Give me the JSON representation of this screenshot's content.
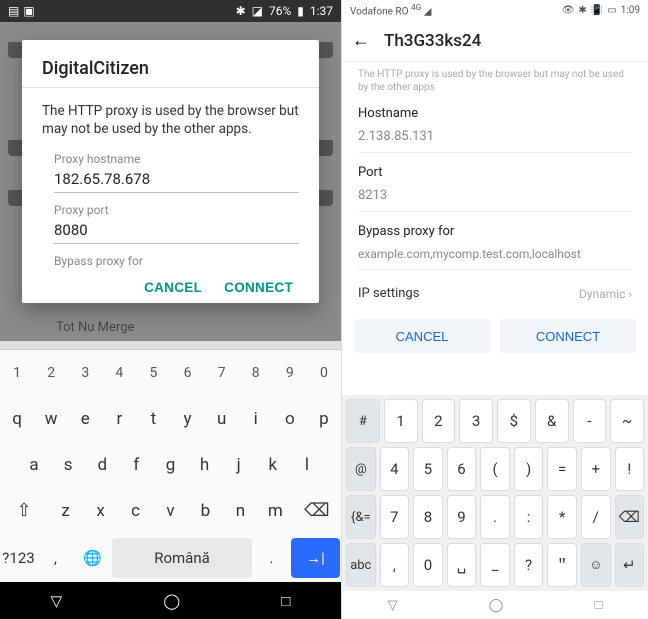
{
  "left": {
    "status": {
      "battery": "76%",
      "time": "1:37"
    },
    "modal": {
      "title": "DigitalCitizen",
      "description": "The HTTP proxy is used by the browser but may not be used by the other apps.",
      "hostname_label": "Proxy hostname",
      "hostname_value": "182.65.78.678",
      "port_label": "Proxy port",
      "port_value": "8080",
      "bypass_label": "Bypass proxy for",
      "cancel": "CANCEL",
      "connect": "CONNECT"
    },
    "bg_network": "Tot Nu Merge",
    "keyboard": {
      "numrow": [
        "1",
        "2",
        "3",
        "4",
        "5",
        "6",
        "7",
        "8",
        "9",
        "0"
      ],
      "row1": [
        "q",
        "w",
        "e",
        "r",
        "t",
        "y",
        "u",
        "i",
        "o",
        "p"
      ],
      "row2": [
        "a",
        "s",
        "d",
        "f",
        "g",
        "h",
        "j",
        "k",
        "l"
      ],
      "row3": [
        "⇧",
        "z",
        "x",
        "c",
        "v",
        "b",
        "n",
        "m",
        "⌫"
      ],
      "row4": {
        "sym": "?123",
        "comma": ",",
        "globe": "🌐",
        "space": "Română",
        "dot": ".",
        "enter": "→|"
      }
    }
  },
  "right": {
    "status": {
      "carrier": "Vodafone RO",
      "time": "1:09"
    },
    "header": {
      "title": "Th3G33ks24"
    },
    "description": "The HTTP proxy is used by the browser but may not be used by the other apps",
    "hostname_label": "Hostname",
    "hostname_value": "2.138.85.131",
    "port_label": "Port",
    "port_value": "8213",
    "bypass_label": "Bypass proxy for",
    "bypass_placeholder": "example.com,mycomp.test.com,localhost",
    "ip_label": "IP settings",
    "ip_value": "Dynamic",
    "cancel": "CANCEL",
    "connect": "CONNECT",
    "keyboard": {
      "r1": [
        "#",
        "1",
        "2",
        "3",
        "$",
        "&",
        "-",
        "~"
      ],
      "r2": [
        "@",
        "4",
        "5",
        "6",
        "(",
        ")",
        "=",
        "+",
        "!"
      ],
      "r3": [
        "{&=",
        "7",
        "8",
        "9",
        ".",
        ":",
        "*",
        "/",
        "⌫"
      ],
      "r4": [
        "abc",
        ",",
        "0",
        "␣",
        "_",
        "?",
        "＂",
        "☺",
        "↵"
      ]
    }
  }
}
